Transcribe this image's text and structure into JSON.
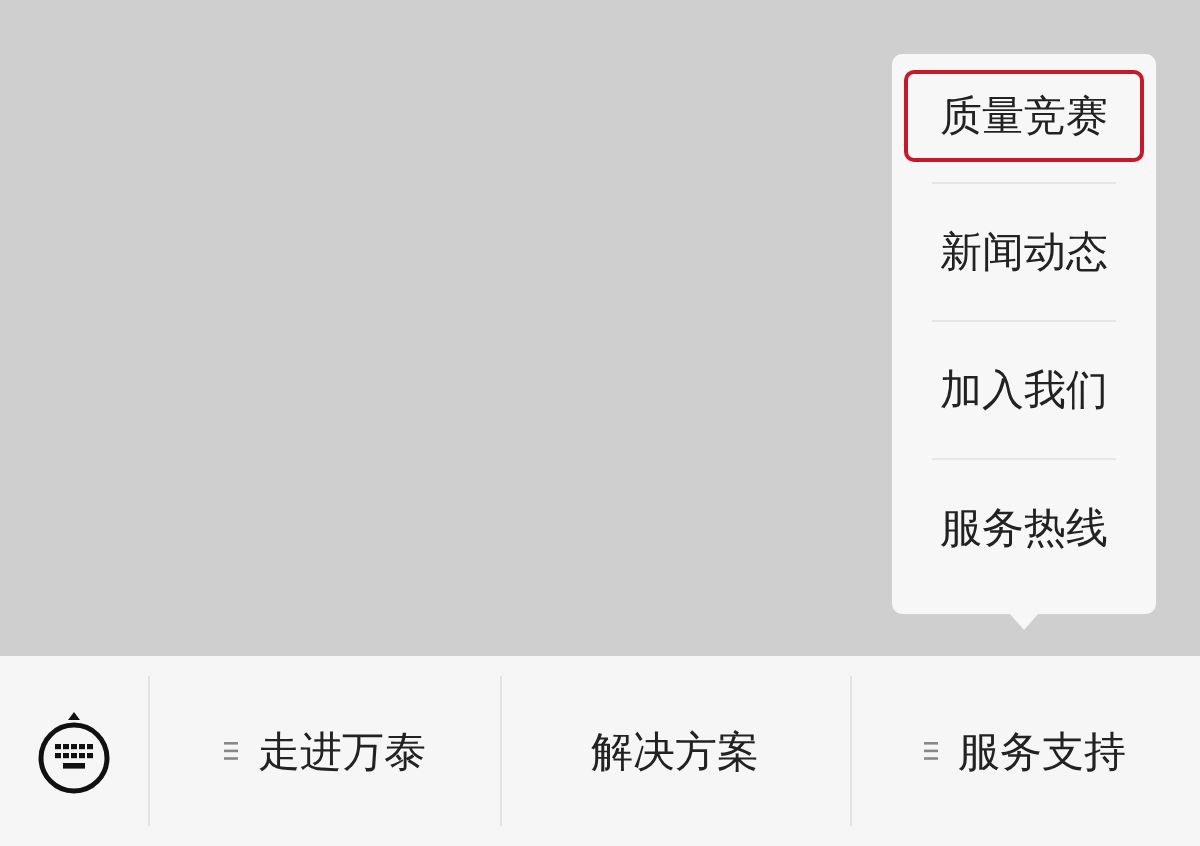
{
  "popup_menu": {
    "items": [
      {
        "label": "质量竞赛",
        "selected": true
      },
      {
        "label": "新闻动态",
        "selected": false
      },
      {
        "label": "加入我们",
        "selected": false
      },
      {
        "label": "服务热线",
        "selected": false
      }
    ]
  },
  "bottom_menu": {
    "items": [
      {
        "label": "走进万泰",
        "has_submenu": true
      },
      {
        "label": "解决方案",
        "has_submenu": false
      },
      {
        "label": "服务支持",
        "has_submenu": true
      }
    ]
  }
}
